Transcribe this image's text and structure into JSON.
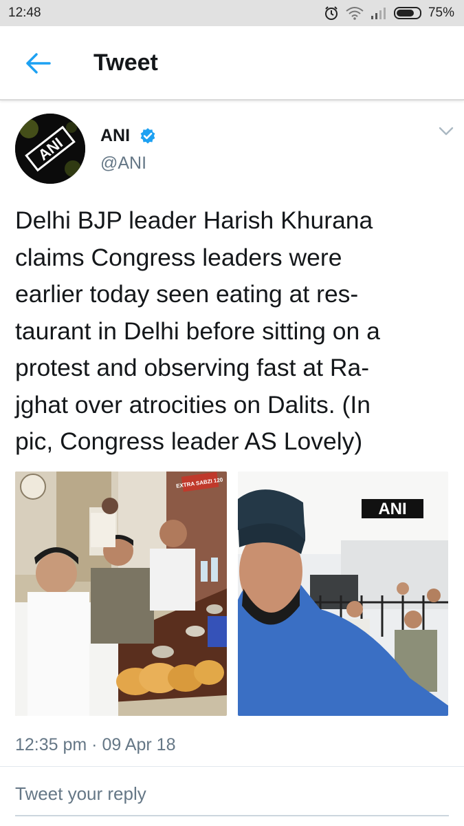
{
  "status_bar": {
    "time": "12:48",
    "icons": [
      "alarm-icon",
      "wifi-icon",
      "signal-icon",
      "battery-icon"
    ],
    "battery_percent": "75%",
    "battery_level": 0.75
  },
  "app_bar": {
    "back_icon": "arrow-left-icon",
    "title": "Tweet",
    "accent_color": "#1da1f2"
  },
  "tweet": {
    "author": {
      "name": "ANI",
      "handle": "@ANI",
      "verified": true,
      "avatar_logo_text": "ANI"
    },
    "text": "Delhi BJP leader Harish Khurana claims Congress leaders were earlier today seen eating at res-taurant in Delhi before sitting on a protest and observing fast at Ra-jghat over atrocities on Dalits. (In pic, Congress leader AS Lovely)",
    "text_lines": [
      "Delhi BJP leader Harish Khurana",
      "claims Congress leaders were",
      "earlier today seen eating at res-",
      "taurant in Delhi before sitting on a",
      "protest and observing fast at Ra-",
      "jghat over atrocities on Dalits. (In",
      "pic, Congress leader AS Lovely)"
    ],
    "media": [
      {
        "name": "restaurant-photo",
        "sign_text": "EXTRA SABZI 120"
      },
      {
        "name": "selfie-photo",
        "watermark": "ANI"
      }
    ],
    "timestamp": "12:35 pm · 09 Apr 18"
  },
  "reply": {
    "placeholder": "Tweet your reply"
  }
}
